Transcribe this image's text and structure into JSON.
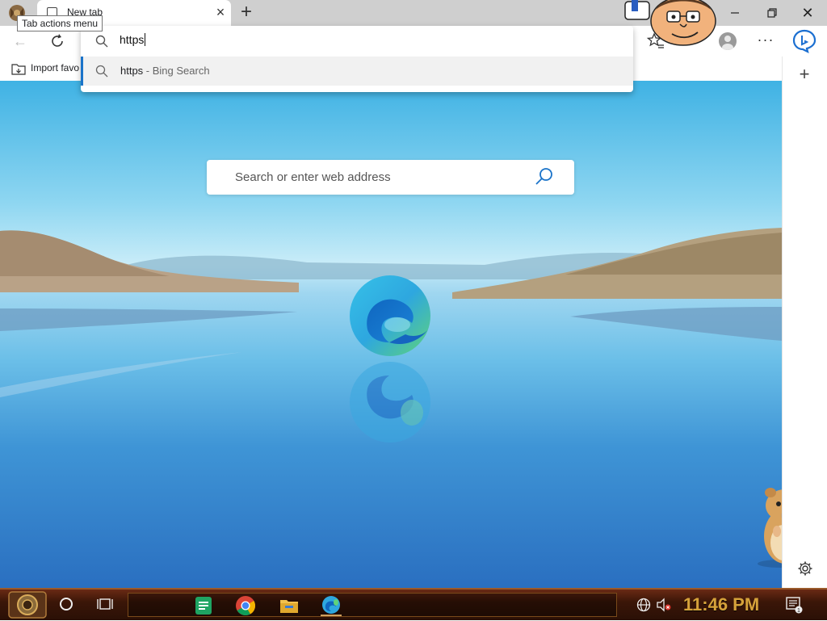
{
  "window": {
    "tab": {
      "title": "New tab"
    },
    "tooltip": "Tab actions menu",
    "controls": {
      "minimize": "minimize",
      "maximize": "maximize",
      "close": "close"
    }
  },
  "toolbar": {
    "icons": [
      "back-arrow-icon",
      "refresh-icon",
      "favorites-star-icon",
      "profile-avatar",
      "more-icon",
      "bing-chat-icon"
    ]
  },
  "favorites_bar": {
    "import_label": "Import favo"
  },
  "omnibox": {
    "input_value": "https",
    "suggestion": {
      "query": "https",
      "separator": " - ",
      "engine": "Bing Search"
    }
  },
  "new_tab_page": {
    "search_placeholder": "Search or enter web address"
  },
  "taskbar": {
    "pinned": [
      "google-sheets-icon",
      "chrome-icon",
      "file-explorer-icon",
      "edge-icon"
    ],
    "clock": "11:46 PM",
    "notification_count": "1"
  },
  "colors": {
    "accent": "#1a73c9",
    "clock": "#d6a23a",
    "taskbar": "#3b1608"
  }
}
